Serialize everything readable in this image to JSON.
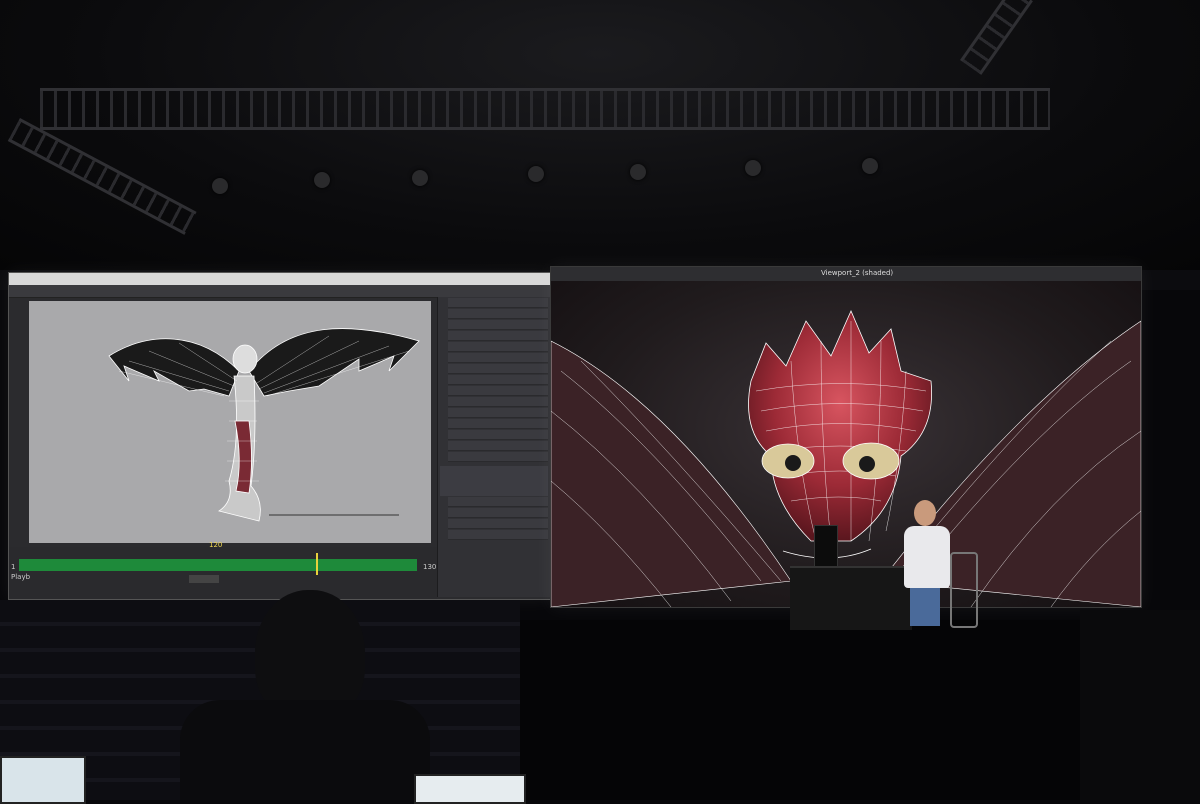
{
  "scene": "presentation stage with two projection screens",
  "left_screen": {
    "timeline_current_frame": "120",
    "timeline_end_frame": "130",
    "timeline_start_frame": "1",
    "playback_label": "Playb",
    "sidebar_section": "Channel Box / Layer Editor"
  },
  "right_screen": {
    "window_title": "Viewport_2 (shaded)"
  },
  "colors": {
    "timeline_track": "#1e8a3a",
    "playhead": "#e8d23c",
    "dragon_head": "#a8323c"
  }
}
